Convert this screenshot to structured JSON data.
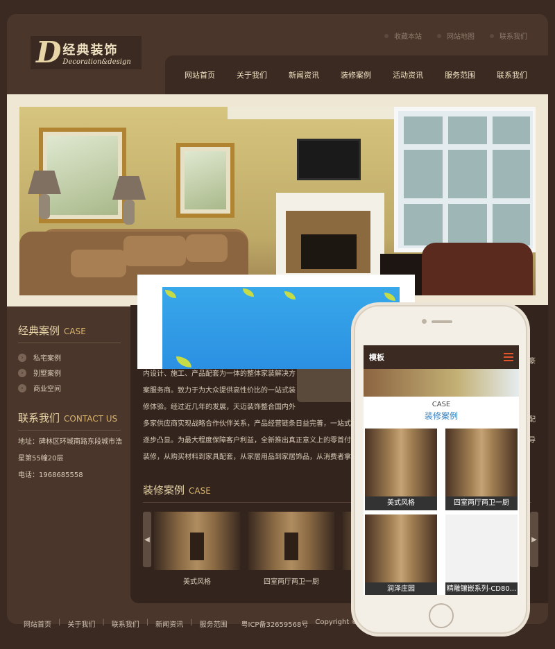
{
  "top_links": [
    "收藏本站",
    "网站地图",
    "联系我们"
  ],
  "logo": {
    "letter": "D",
    "cn": "经典装饰",
    "en": "Decoration&design"
  },
  "nav": [
    "网站首页",
    "关于我们",
    "新闻资讯",
    "装修案例",
    "活动资讯",
    "服务范围",
    "联系我们"
  ],
  "sidebar": {
    "case_title": "经典案例",
    "case_title_en": "CASE",
    "items": [
      "私宅案例",
      "别墅案例",
      "商业空间"
    ],
    "contact_title": "联系我们",
    "contact_title_en": "CONTACT US",
    "address_line1": "地址：碑林区环城南路东段城市浩",
    "address_line2": "星第55幢20层",
    "phone": "电话：1968685558"
  },
  "about": {
    "lines": [
      "内设计、施工、产品配套为一体的整体家装解决方",
      "案服务商。致力于为大众提供高性价比的一站式装",
      "修体验。经过近几年的发展，天迈装饰整合国内外",
      "多家供应商实现战略合作伙伴关系，产品经营链条日益完善，一站式装修",
      "逐步凸显。为最大程度保障客户利益，全新推出真正意义上的零首付装修",
      "装修，从购买材料到家具配套，从家居用品到家居饰品，从消费者拿到房子"
    ]
  },
  "case_section": {
    "title": "装修案例",
    "title_en": "CASE",
    "cards": [
      "美式风格",
      "四室两厅两卫一厨"
    ],
    "arrow_left": "◀",
    "arrow_right": "▶"
  },
  "right_snippets": [
    "豪",
    "配",
    "导"
  ],
  "footer": {
    "links": [
      "网站首页",
      "关于我们",
      "联系我们",
      "新闻资讯",
      "服务范围"
    ],
    "separator": "|",
    "icp": "粤ICP备32659568号",
    "copyright": "Copyright © 2002-20"
  },
  "phone": {
    "header_logo": "模板",
    "case_en": "CASE",
    "case_cn": "装修案例",
    "items": [
      "美式风格",
      "四室两厅两卫一厨",
      "润泽庄园",
      "精雕镶嵌系列-CD80..."
    ]
  },
  "colors": {
    "background": "#3b2a22",
    "frame": "#4a362b",
    "accent_gold": "#d9b46e",
    "phone_link": "#2b7bbd"
  }
}
